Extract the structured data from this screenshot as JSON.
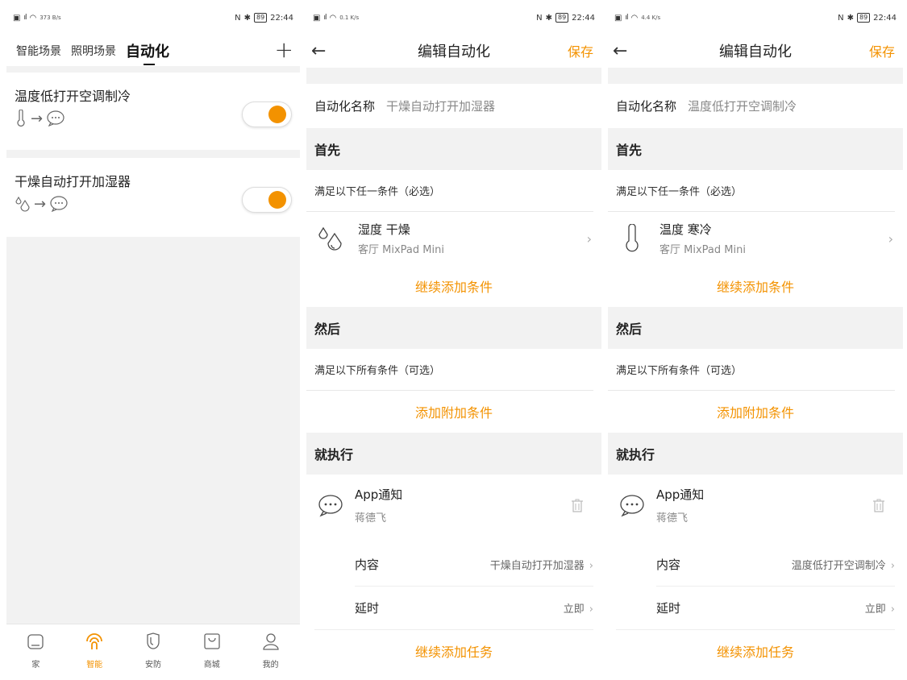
{
  "status": {
    "time": "22:44",
    "battery": "89",
    "net_s1": "373 B/s",
    "net_s2": "0.1 K/s",
    "net_s3": "4.4 K/s"
  },
  "list": {
    "tabs": [
      "智能场景",
      "照明场景",
      "自动化"
    ],
    "automations": [
      {
        "title": "温度低打开空调制冷",
        "trigger_icon": "thermometer-icon",
        "action_icon": "message-icon",
        "enabled": true
      },
      {
        "title": "干燥自动打开加湿器",
        "trigger_icon": "humidity-icon",
        "action_icon": "message-icon",
        "enabled": true
      }
    ],
    "nav": [
      {
        "label": "家",
        "icon": "home-icon"
      },
      {
        "label": "智能",
        "icon": "smart-icon",
        "active": true
      },
      {
        "label": "安防",
        "icon": "shield-icon"
      },
      {
        "label": "商城",
        "icon": "shop-icon"
      },
      {
        "label": "我的",
        "icon": "profile-icon"
      }
    ],
    "accent": "#f39200"
  },
  "edit": [
    {
      "title": "编辑自动化",
      "save": "保存",
      "name_label": "自动化名称",
      "name_value": "干燥自动打开加湿器",
      "first": "首先",
      "first_hint": "满足以下任一条件（必选）",
      "condition_title": "湿度 干燥",
      "condition_device": "客厅 MixPad Mini",
      "condition_icon": "humidity-icon",
      "add_condition": "继续添加条件",
      "then": "然后",
      "then_hint": "满足以下所有条件（可选）",
      "add_extra": "添加附加条件",
      "do": "就执行",
      "task_title": "App通知",
      "task_user": "蒋德飞",
      "content_label": "内容",
      "content_value": "干燥自动打开加湿器",
      "delay_label": "延时",
      "delay_value": "立即",
      "add_task": "继续添加任务"
    },
    {
      "title": "编辑自动化",
      "save": "保存",
      "name_label": "自动化名称",
      "name_value": "温度低打开空调制冷",
      "first": "首先",
      "first_hint": "满足以下任一条件（必选）",
      "condition_title": "温度 寒冷",
      "condition_device": "客厅 MixPad Mini",
      "condition_icon": "thermometer-icon",
      "add_condition": "继续添加条件",
      "then": "然后",
      "then_hint": "满足以下所有条件（可选）",
      "add_extra": "添加附加条件",
      "do": "就执行",
      "task_title": "App通知",
      "task_user": "蒋德飞",
      "content_label": "内容",
      "content_value": "温度低打开空调制冷",
      "delay_label": "延时",
      "delay_value": "立即",
      "add_task": "继续添加任务"
    }
  ]
}
